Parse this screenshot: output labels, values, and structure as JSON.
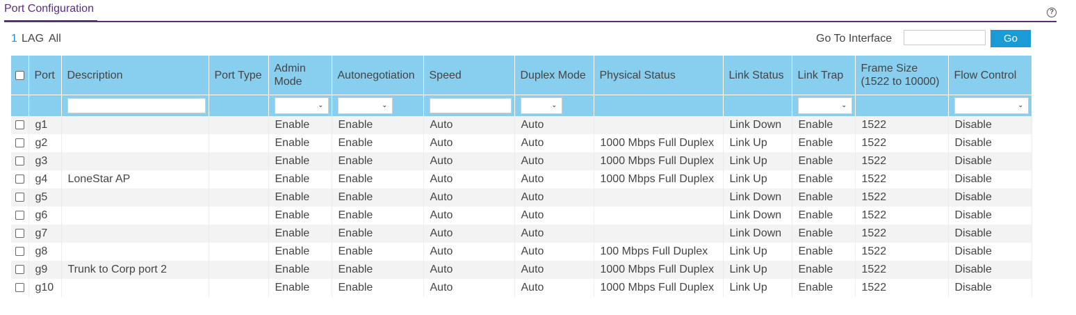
{
  "header": {
    "title": "Port Configuration",
    "help_icon": "help-circle-icon"
  },
  "toolbar": {
    "one": "1",
    "lag": "LAG",
    "all": "All",
    "goto_label": "Go To Interface",
    "goto_value": "",
    "go_button": "Go"
  },
  "columns": {
    "port": "Port",
    "description": "Description",
    "port_type": "Port Type",
    "admin_mode": "Admin Mode",
    "autonegotiation": "Autonegotiation",
    "speed": "Speed",
    "duplex_mode": "Duplex Mode",
    "physical_status": "Physical Status",
    "link_status": "Link Status",
    "link_trap": "Link Trap",
    "frame_size": "Frame Size (1522 to 10000)",
    "flow_control": "Flow Control"
  },
  "rows": [
    {
      "port": "g1",
      "description": "",
      "port_type": "",
      "admin_mode": "Enable",
      "autonegotiation": "Enable",
      "speed": "Auto",
      "duplex_mode": "Auto",
      "physical_status": "",
      "link_status": "Link Down",
      "link_trap": "Enable",
      "frame_size": "1522",
      "flow_control": "Disable"
    },
    {
      "port": "g2",
      "description": "",
      "port_type": "",
      "admin_mode": "Enable",
      "autonegotiation": "Enable",
      "speed": "Auto",
      "duplex_mode": "Auto",
      "physical_status": "1000 Mbps Full Duplex",
      "link_status": "Link Up",
      "link_trap": "Enable",
      "frame_size": "1522",
      "flow_control": "Disable"
    },
    {
      "port": "g3",
      "description": "",
      "port_type": "",
      "admin_mode": "Enable",
      "autonegotiation": "Enable",
      "speed": "Auto",
      "duplex_mode": "Auto",
      "physical_status": "1000 Mbps Full Duplex",
      "link_status": "Link Up",
      "link_trap": "Enable",
      "frame_size": "1522",
      "flow_control": "Disable"
    },
    {
      "port": "g4",
      "description": "LoneStar AP",
      "port_type": "",
      "admin_mode": "Enable",
      "autonegotiation": "Enable",
      "speed": "Auto",
      "duplex_mode": "Auto",
      "physical_status": "1000 Mbps Full Duplex",
      "link_status": "Link Up",
      "link_trap": "Enable",
      "frame_size": "1522",
      "flow_control": "Disable"
    },
    {
      "port": "g5",
      "description": "",
      "port_type": "",
      "admin_mode": "Enable",
      "autonegotiation": "Enable",
      "speed": "Auto",
      "duplex_mode": "Auto",
      "physical_status": "",
      "link_status": "Link Down",
      "link_trap": "Enable",
      "frame_size": "1522",
      "flow_control": "Disable"
    },
    {
      "port": "g6",
      "description": "",
      "port_type": "",
      "admin_mode": "Enable",
      "autonegotiation": "Enable",
      "speed": "Auto",
      "duplex_mode": "Auto",
      "physical_status": "",
      "link_status": "Link Down",
      "link_trap": "Enable",
      "frame_size": "1522",
      "flow_control": "Disable"
    },
    {
      "port": "g7",
      "description": "",
      "port_type": "",
      "admin_mode": "Enable",
      "autonegotiation": "Enable",
      "speed": "Auto",
      "duplex_mode": "Auto",
      "physical_status": "",
      "link_status": "Link Down",
      "link_trap": "Enable",
      "frame_size": "1522",
      "flow_control": "Disable"
    },
    {
      "port": "g8",
      "description": "",
      "port_type": "",
      "admin_mode": "Enable",
      "autonegotiation": "Enable",
      "speed": "Auto",
      "duplex_mode": "Auto",
      "physical_status": "100 Mbps Full Duplex",
      "link_status": "Link Up",
      "link_trap": "Enable",
      "frame_size": "1522",
      "flow_control": "Disable"
    },
    {
      "port": "g9",
      "description": "Trunk to Corp port 2",
      "port_type": "",
      "admin_mode": "Enable",
      "autonegotiation": "Enable",
      "speed": "Auto",
      "duplex_mode": "Auto",
      "physical_status": "1000 Mbps Full Duplex",
      "link_status": "Link Up",
      "link_trap": "Enable",
      "frame_size": "1522",
      "flow_control": "Disable"
    },
    {
      "port": "g10",
      "description": "",
      "port_type": "",
      "admin_mode": "Enable",
      "autonegotiation": "Enable",
      "speed": "Auto",
      "duplex_mode": "Auto",
      "physical_status": "1000 Mbps Full Duplex",
      "link_status": "Link Up",
      "link_trap": "Enable",
      "frame_size": "1522",
      "flow_control": "Disable"
    }
  ],
  "colors": {
    "accent": "#5a2d82",
    "header_bg": "#87ceef",
    "go_button": "#1a9bd7",
    "link": "#1f8fd6"
  }
}
